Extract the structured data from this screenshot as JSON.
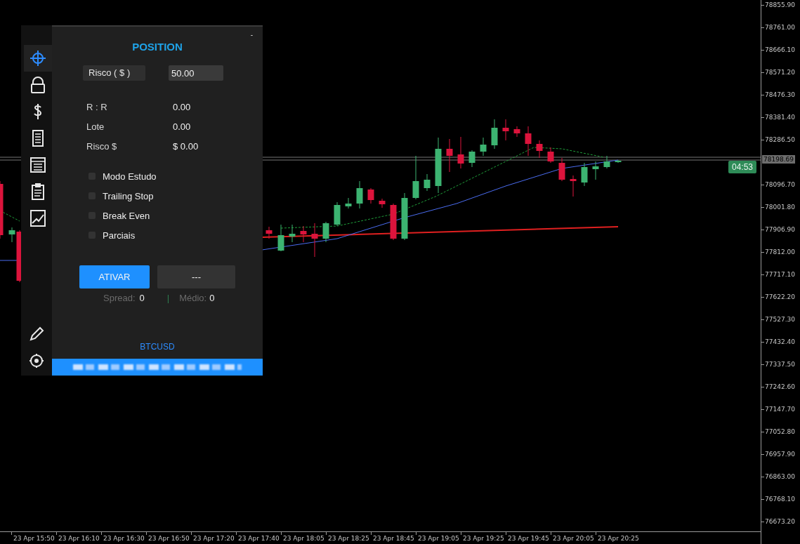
{
  "panel": {
    "title": "POSITION",
    "minimize": "-",
    "sidebar": {
      "items": [
        {
          "selected": true
        },
        {
          "selected": false
        },
        {
          "selected": false
        },
        {
          "selected": false
        },
        {
          "selected": false
        },
        {
          "selected": false
        },
        {
          "selected": false
        }
      ]
    },
    "risk": {
      "label": "Risco ( $ )",
      "value": "50.00"
    },
    "stats": [
      {
        "label": "R : R",
        "value": "0.00"
      },
      {
        "label": "Lote",
        "value": "0.00"
      },
      {
        "label": "Risco $",
        "value": "$ 0.00"
      }
    ],
    "options": [
      {
        "label": "Modo Estudo",
        "checked": false
      },
      {
        "label": "Trailing Stop",
        "checked": false
      },
      {
        "label": "Break Even",
        "checked": false
      },
      {
        "label": "Parciais",
        "checked": false
      }
    ],
    "buttons": [
      {
        "label": "ATIVAR",
        "kind": "primary"
      },
      {
        "label": "---",
        "kind": "secondary"
      }
    ],
    "footer_stats": {
      "spread_label": "Spread:",
      "spread_value": "0",
      "separator": "|",
      "average_label": "Médio:",
      "average_value": "0"
    },
    "symbol": "BTCUSD"
  },
  "chart": {
    "timer": "04:53",
    "current_price": "78198.69",
    "price_axis": [
      "78855.90",
      "78761.00",
      "78666.10",
      "78571.20",
      "78476.30",
      "78381.40",
      "78286.50",
      "78096.70",
      "78001.80",
      "77906.90",
      "77812.00",
      "77717.10",
      "77622.20",
      "77527.30",
      "77432.40",
      "77337.50",
      "77242.60",
      "77147.70",
      "77052.80",
      "76957.90",
      "76863.00",
      "76768.10",
      "76673.20"
    ],
    "time_axis": [
      "23 Apr 15:50",
      "23 Apr 16:10",
      "23 Apr 16:30",
      "23 Apr 16:50",
      "23 Apr 17:20",
      "23 Apr 17:40",
      "23 Apr 18:05",
      "23 Apr 18:25",
      "23 Apr 18:45",
      "23 Apr 19:05",
      "23 Apr 19:25",
      "23 Apr 19:45",
      "23 Apr 20:05",
      "23 Apr 20:25"
    ]
  }
}
